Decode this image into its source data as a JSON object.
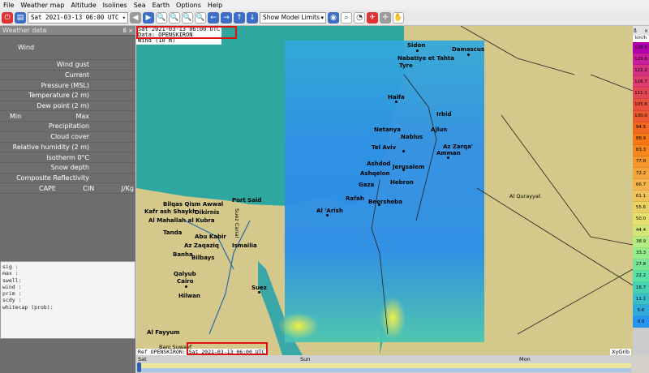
{
  "menu": [
    "File",
    "Weather map",
    "Altitude",
    "Isolines",
    "Sea",
    "Earth",
    "Options",
    "Help"
  ],
  "toolbar": {
    "date_value": "Sat 2021-03-13 06:00 UTC",
    "model_limits": "Show Model Limits"
  },
  "panel": {
    "title": "Weather data",
    "rows": {
      "wind": "Wind",
      "wind_gust": "Wind gust",
      "current": "Current",
      "pressure": "Pressure (MSL)",
      "temperature": "Temperature (2 m)",
      "dew_point": "Dew point (2 m)",
      "min": "Min",
      "max": "Max",
      "precipitation": "Precipitation",
      "cloud_cover": "Cloud cover",
      "rel_humidity": "Relative humidity (2 m)",
      "isotherm": "Isotherm 0°C",
      "snow_depth": "Snow depth",
      "composite_reflectivity": "Composite Reflectivity",
      "cape": "CAPE",
      "cin": "CIN",
      "jkg": "J/Kg"
    },
    "text_lines": [
      "sig  :",
      "max  :",
      "swell:",
      "wind :",
      "prim :",
      "scdy :",
      "whitecap (prob):"
    ]
  },
  "map": {
    "header_date": "Sat 2021-03-13 06:00 UTC",
    "header_source": "Data: OPENSKIRON",
    "header_layer": "Wind (10 m)",
    "footer_label": "Ref OPENSKIRON: Sat 2021-03-13 06:00 UTC",
    "brand": "XyGrib",
    "places": {
      "sidon": "Sidon",
      "nabatiye": "Nabatiye et Tahta",
      "tyre": "Tyre",
      "damascus": "Damascus",
      "haifa": "Haifa",
      "irbid": "Irbid",
      "netanya": "Netanya",
      "nablus": "Nablus",
      "ajlun": "Ajlun",
      "az_zarqa": "Az Zarqa'",
      "amman": "Amman",
      "tel_aviv": "Tel Aviv",
      "ashdod": "Ashdod",
      "jerusalem": "Jerusalem",
      "ashqelon": "Ashqelon",
      "gaza": "Gaza",
      "hebron": "Hebron",
      "rafah": "Rafah",
      "beersheba": "Beersheba",
      "al_arish": "Al 'Arish",
      "al_qurayyat": "Al Qurayyat",
      "port_said": "Port Said",
      "bilqas": "Bilqas Qism Awwal",
      "kafr_ash_shaykh": "Kafr ash Shaykh",
      "dikirnis": "Dikirnis",
      "al_mahallah": "Al Mahallah al Kubra",
      "tanda": "Tanda",
      "abu_kabir": "Abu Kabir",
      "az_zaqaziq": "Az Zaqaziq",
      "ismailia": "Ismailia",
      "banha": "Banha",
      "bilbays": "Bilbays",
      "qalyub": "Qalyub",
      "cairo": "Cairo",
      "suez": "Suez",
      "hilwan": "Hilwan",
      "al_fayyum": "Al Fayyum",
      "bani_suwayf": "Bani Suwayf",
      "suez_canal": "Suez Canal"
    }
  },
  "legend": {
    "unit": "km/h",
    "values": [
      "138.9",
      "129.6",
      "122.2",
      "116.7",
      "111.1",
      "105.6",
      "100.0",
      "94.5",
      "88.9",
      "83.3",
      "77.8",
      "72.2",
      "66.7",
      "61.1",
      "55.6",
      "50.0",
      "44.4",
      "38.9",
      "33.3",
      "27.8",
      "22.2",
      "16.7",
      "11.1",
      "5.6",
      "0.0"
    ],
    "colors": [
      "#b000b0",
      "#c81e9b",
      "#d23282",
      "#dc3c6e",
      "#e14655",
      "#e6503c",
      "#eb5a2d",
      "#f0691e",
      "#f57814",
      "#f5871e",
      "#f5962d",
      "#f5a53c",
      "#f5b44b",
      "#f0c35a",
      "#ebd264",
      "#e6e16e",
      "#d2e678",
      "#b4eb82",
      "#96eb8c",
      "#78e696",
      "#5ae1a5",
      "#46d2b4",
      "#3cbec8",
      "#32aadc",
      "#2896f0"
    ]
  },
  "timeline": {
    "labels": [
      "Sat",
      "Sun",
      "Mon"
    ]
  }
}
